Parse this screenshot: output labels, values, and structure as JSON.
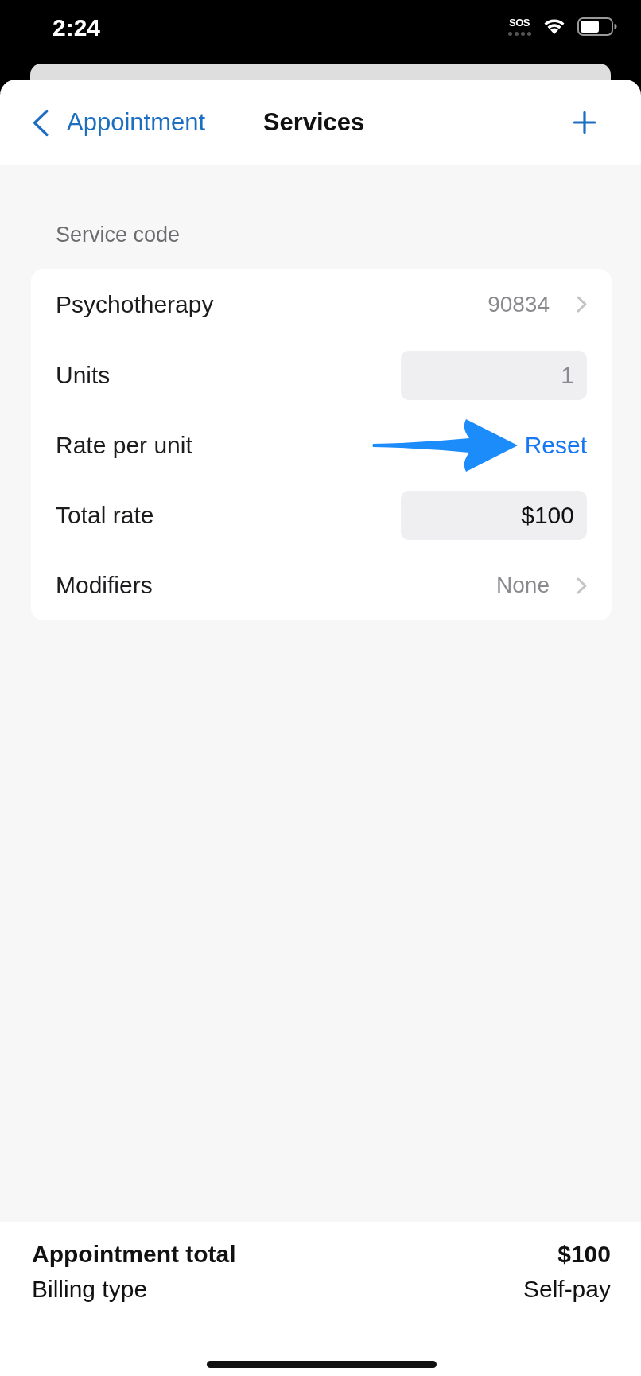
{
  "status_bar": {
    "time": "2:24",
    "emergency_label": "SOS"
  },
  "nav": {
    "back": "Appointment",
    "title": "Services"
  },
  "section": {
    "header": "Service code",
    "rows": [
      {
        "kind": "link",
        "label": "Psychotherapy",
        "value": "90834"
      },
      {
        "kind": "input",
        "label": "Units",
        "placeholder": "1"
      },
      {
        "kind": "action",
        "label": "Rate per unit",
        "action": "Reset",
        "callout_arrow": true
      },
      {
        "kind": "input",
        "label": "Total rate",
        "value": "$100"
      },
      {
        "kind": "link",
        "label": "Modifiers",
        "value": "None"
      }
    ]
  },
  "footer": {
    "rows": [
      {
        "label": "Appointment total",
        "value": "$100",
        "emphasis": true
      },
      {
        "label": "Billing type",
        "value": "Self-pay",
        "emphasis": false
      }
    ]
  }
}
